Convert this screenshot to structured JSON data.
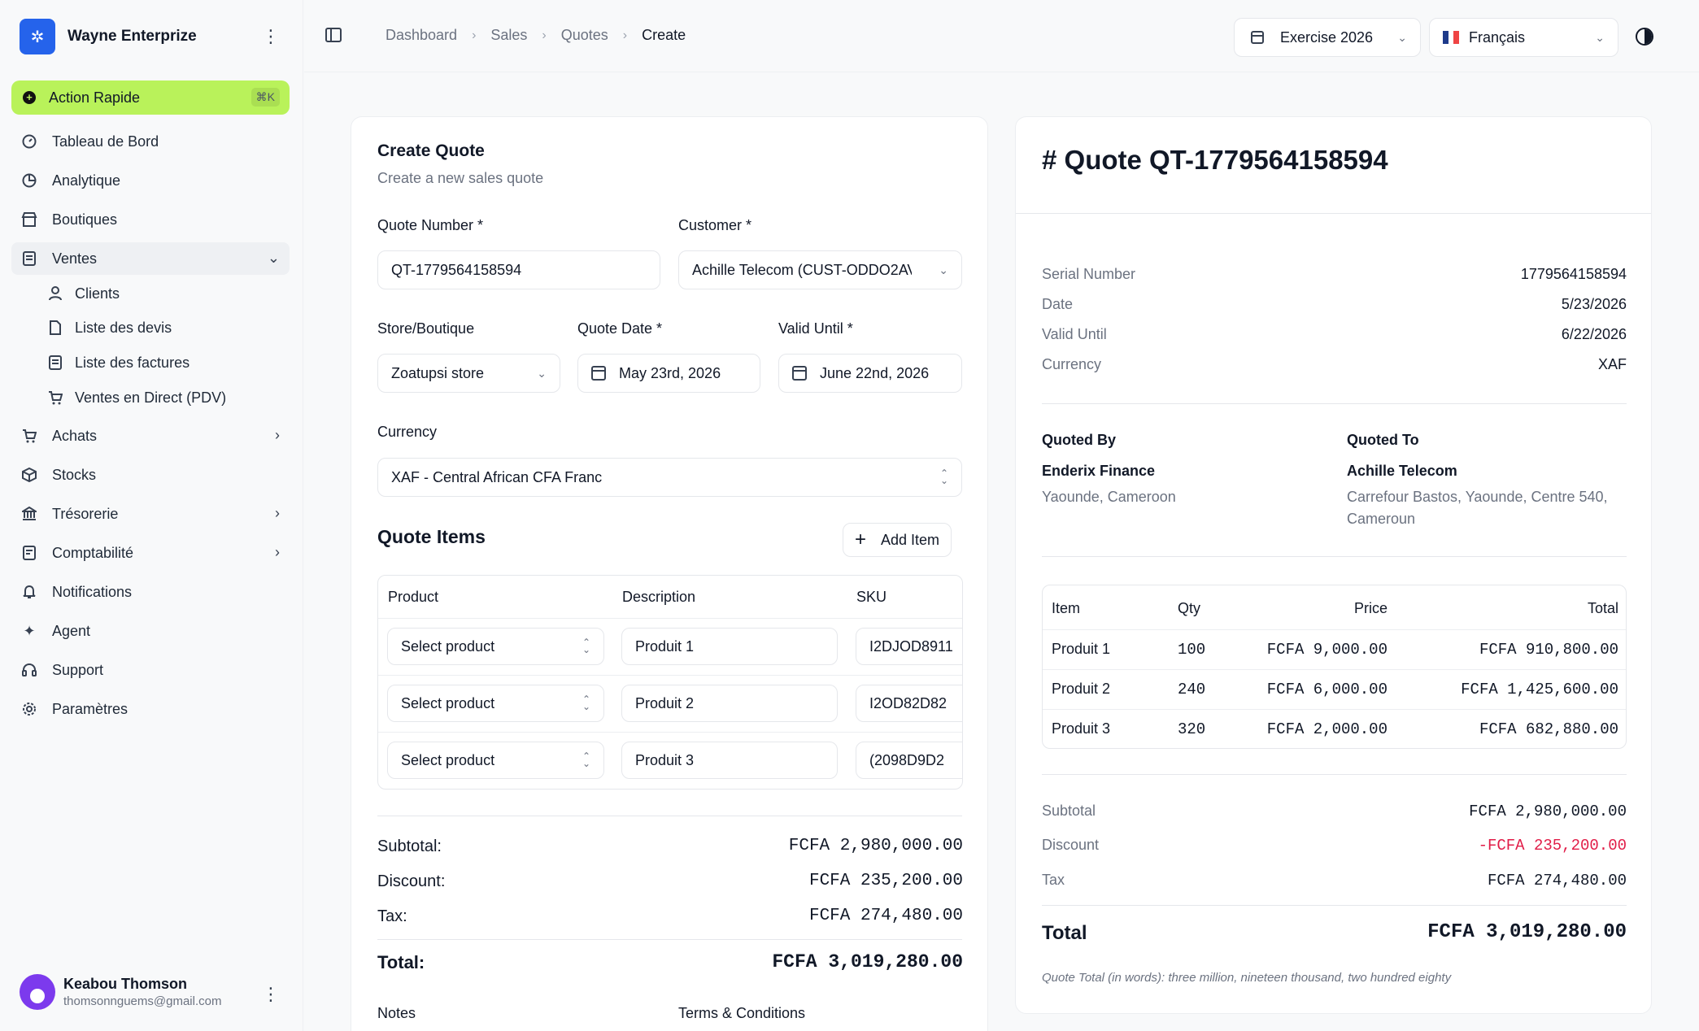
{
  "sidebar": {
    "brand": "Wayne Enterprize",
    "quick_action": {
      "label": "Action Rapide",
      "shortcut": "⌘K"
    },
    "items": [
      {
        "label": "Tableau de Bord",
        "icon": "dashboard-icon"
      },
      {
        "label": "Analytique",
        "icon": "chart-pie-icon"
      },
      {
        "label": "Boutiques",
        "icon": "store-icon"
      },
      {
        "label": "Ventes",
        "icon": "receipt-icon",
        "expanded": true
      },
      {
        "label": "Achats",
        "icon": "cart-icon"
      },
      {
        "label": "Stocks",
        "icon": "box-icon"
      },
      {
        "label": "Trésorerie",
        "icon": "bank-icon"
      },
      {
        "label": "Comptabilité",
        "icon": "ledger-icon"
      },
      {
        "label": "Notifications",
        "icon": "bell-icon"
      },
      {
        "label": "Agent",
        "icon": "sparkles-icon"
      },
      {
        "label": "Support",
        "icon": "headset-icon"
      },
      {
        "label": "Paramètres",
        "icon": "gear-icon"
      }
    ],
    "sub_items": [
      {
        "label": "Clients",
        "icon": "user-icon"
      },
      {
        "label": "Liste des devis",
        "icon": "document-icon"
      },
      {
        "label": "Liste des factures",
        "icon": "invoice-icon"
      },
      {
        "label": "Ventes en Direct (PDV)",
        "icon": "cart-icon"
      }
    ],
    "user": {
      "name": "Keabou Thomson",
      "email": "thomsonnguems@gmail.com"
    }
  },
  "topbar": {
    "breadcrumbs": [
      "Dashboard",
      "Sales",
      "Quotes",
      "Create"
    ],
    "fiscal_year": "Exercise 2026",
    "language": "Français"
  },
  "form": {
    "title": "Create Quote",
    "subtitle": "Create a new sales quote",
    "quote_number_label": "Quote Number *",
    "quote_number": "QT-1779564158594",
    "customer_label": "Customer *",
    "customer": "Achille Telecom (CUST-ODDO2AV",
    "store_label": "Store/Boutique",
    "store": "Zoatupsi store",
    "quote_date_label": "Quote Date *",
    "quote_date": "May 23rd, 2026",
    "valid_until_label": "Valid Until *",
    "valid_until": "June 22nd, 2026",
    "currency_label": "Currency",
    "currency": "XAF - Central African CFA Franc",
    "items_title": "Quote Items",
    "add_item": "Add Item",
    "columns": [
      "Product",
      "Description",
      "SKU"
    ],
    "items": [
      {
        "product": "Select product",
        "description": "Produit 1",
        "sku": "I2DJOD8911"
      },
      {
        "product": "Select product",
        "description": "Produit 2",
        "sku": "I2OD82D82"
      },
      {
        "product": "Select product",
        "description": "Produit 3",
        "sku": "(2098D9D2"
      }
    ],
    "totals": {
      "subtotal_label": "Subtotal:",
      "subtotal": "FCFA 2,980,000.00",
      "discount_label": "Discount:",
      "discount": "FCFA 235,200.00",
      "tax_label": "Tax:",
      "tax": "FCFA 274,480.00",
      "total_label": "Total:",
      "total": "FCFA 3,019,280.00"
    },
    "notes_label": "Notes",
    "terms_label": "Terms & Conditions"
  },
  "preview": {
    "title": "# Quote QT-1779564158594",
    "meta": [
      {
        "k": "Serial Number",
        "v": "1779564158594"
      },
      {
        "k": "Date",
        "v": "5/23/2026"
      },
      {
        "k": "Valid Until",
        "v": "6/22/2026"
      },
      {
        "k": "Currency",
        "v": "XAF"
      }
    ],
    "quoted_by_label": "Quoted By",
    "quoted_by_name": "Enderix Finance",
    "quoted_by_address": "Yaounde, Cameroon",
    "quoted_to_label": "Quoted To",
    "quoted_to_name": "Achille Telecom",
    "quoted_to_address": "Carrefour Bastos, Yaounde, Centre 540, Cameroun",
    "columns": [
      "Item",
      "Qty",
      "Price",
      "Total"
    ],
    "rows": [
      {
        "item": "Produit 1",
        "qty": "100",
        "price": "FCFA 9,000.00",
        "total": "FCFA 910,800.00"
      },
      {
        "item": "Produit 2",
        "qty": "240",
        "price": "FCFA 6,000.00",
        "total": "FCFA 1,425,600.00"
      },
      {
        "item": "Produit 3",
        "qty": "320",
        "price": "FCFA 2,000.00",
        "total": "FCFA 682,880.00"
      }
    ],
    "subtotal_label": "Subtotal",
    "subtotal": "FCFA 2,980,000.00",
    "discount_label": "Discount",
    "discount": "-FCFA 235,200.00",
    "tax_label": "Tax",
    "tax": "FCFA 274,480.00",
    "total_label": "Total",
    "total": "FCFA 3,019,280.00",
    "total_words": "Quote Total (in words): three million, nineteen thousand, two hundred eighty"
  },
  "colors": {
    "accent": "#b9f25a",
    "brand": "#2563eb",
    "negative": "#e11d48"
  }
}
